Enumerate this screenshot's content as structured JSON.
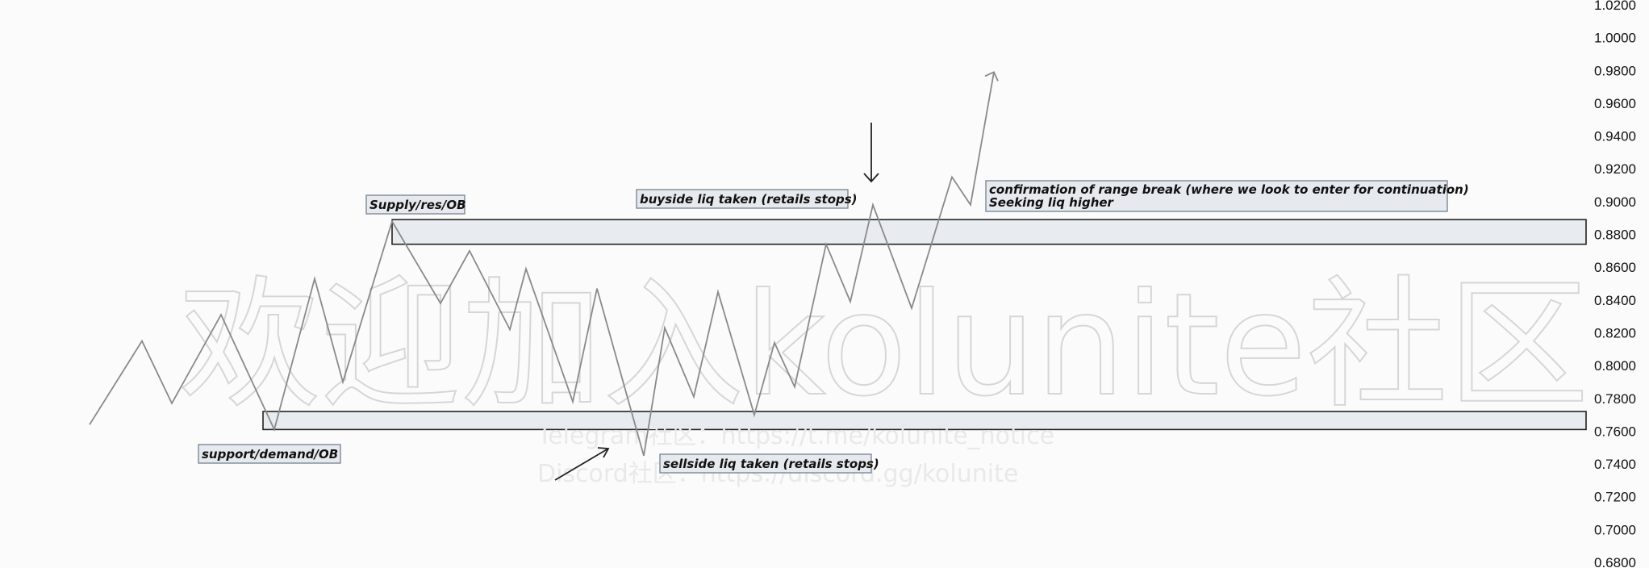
{
  "chart_data": {
    "type": "line",
    "title": "",
    "xlabel": "",
    "ylabel": "",
    "ylim": [
      0.68,
      1.02
    ],
    "y_ticks": [
      "1.0200",
      "1.0000",
      "0.9800",
      "0.9600",
      "0.9400",
      "0.9200",
      "0.9000",
      "0.8800",
      "0.8600",
      "0.8400",
      "0.8200",
      "0.8000",
      "0.7800",
      "0.7600",
      "0.7400",
      "0.7200",
      "0.7000",
      "0.6800"
    ],
    "y_tick_values": [
      1.02,
      1.0,
      0.98,
      0.96,
      0.94,
      0.92,
      0.9,
      0.88,
      0.86,
      0.84,
      0.82,
      0.8,
      0.78,
      0.76,
      0.74,
      0.72,
      0.7,
      0.68
    ],
    "series": [
      {
        "values": [
          0.764,
          0.815,
          0.777,
          0.831,
          0.761,
          0.853,
          0.79,
          0.888,
          0.838,
          0.87,
          0.822,
          0.859,
          0.778,
          0.847,
          0.745,
          0.823,
          0.781,
          0.845,
          0.77,
          0.814,
          0.787,
          0.874,
          0.839,
          0.898,
          0.835,
          0.915,
          0.898,
          0.979
        ]
      }
    ],
    "zones": [
      {
        "label": "Supply/res/OB",
        "low": 0.874,
        "high": 0.889
      },
      {
        "label": "support/demand/OB",
        "low": 0.761,
        "high": 0.772
      }
    ],
    "annotations": [
      "Supply/res/OB",
      "support/demand/OB",
      "buyside liq taken (retails stops)",
      "sellside liq taken (retails stops)",
      "confirmation of range break (where we look to enter for continuation)",
      "Seeking liq higher"
    ],
    "colors": {
      "line": "#8a8a8a",
      "zone_fill": "#e8ebef",
      "zone_border": "#222222",
      "label_fill": "#e6e9ed",
      "label_border": "#7d8a97",
      "background": "#fbfbfb"
    },
    "grid": false
  },
  "watermark": {
    "main": "欢迎加入kolunite社区",
    "telegram": "Telegram社区：https://t.me/kolunite_notice",
    "discord": "Discord社区：https://discord.gg/kolunite"
  }
}
